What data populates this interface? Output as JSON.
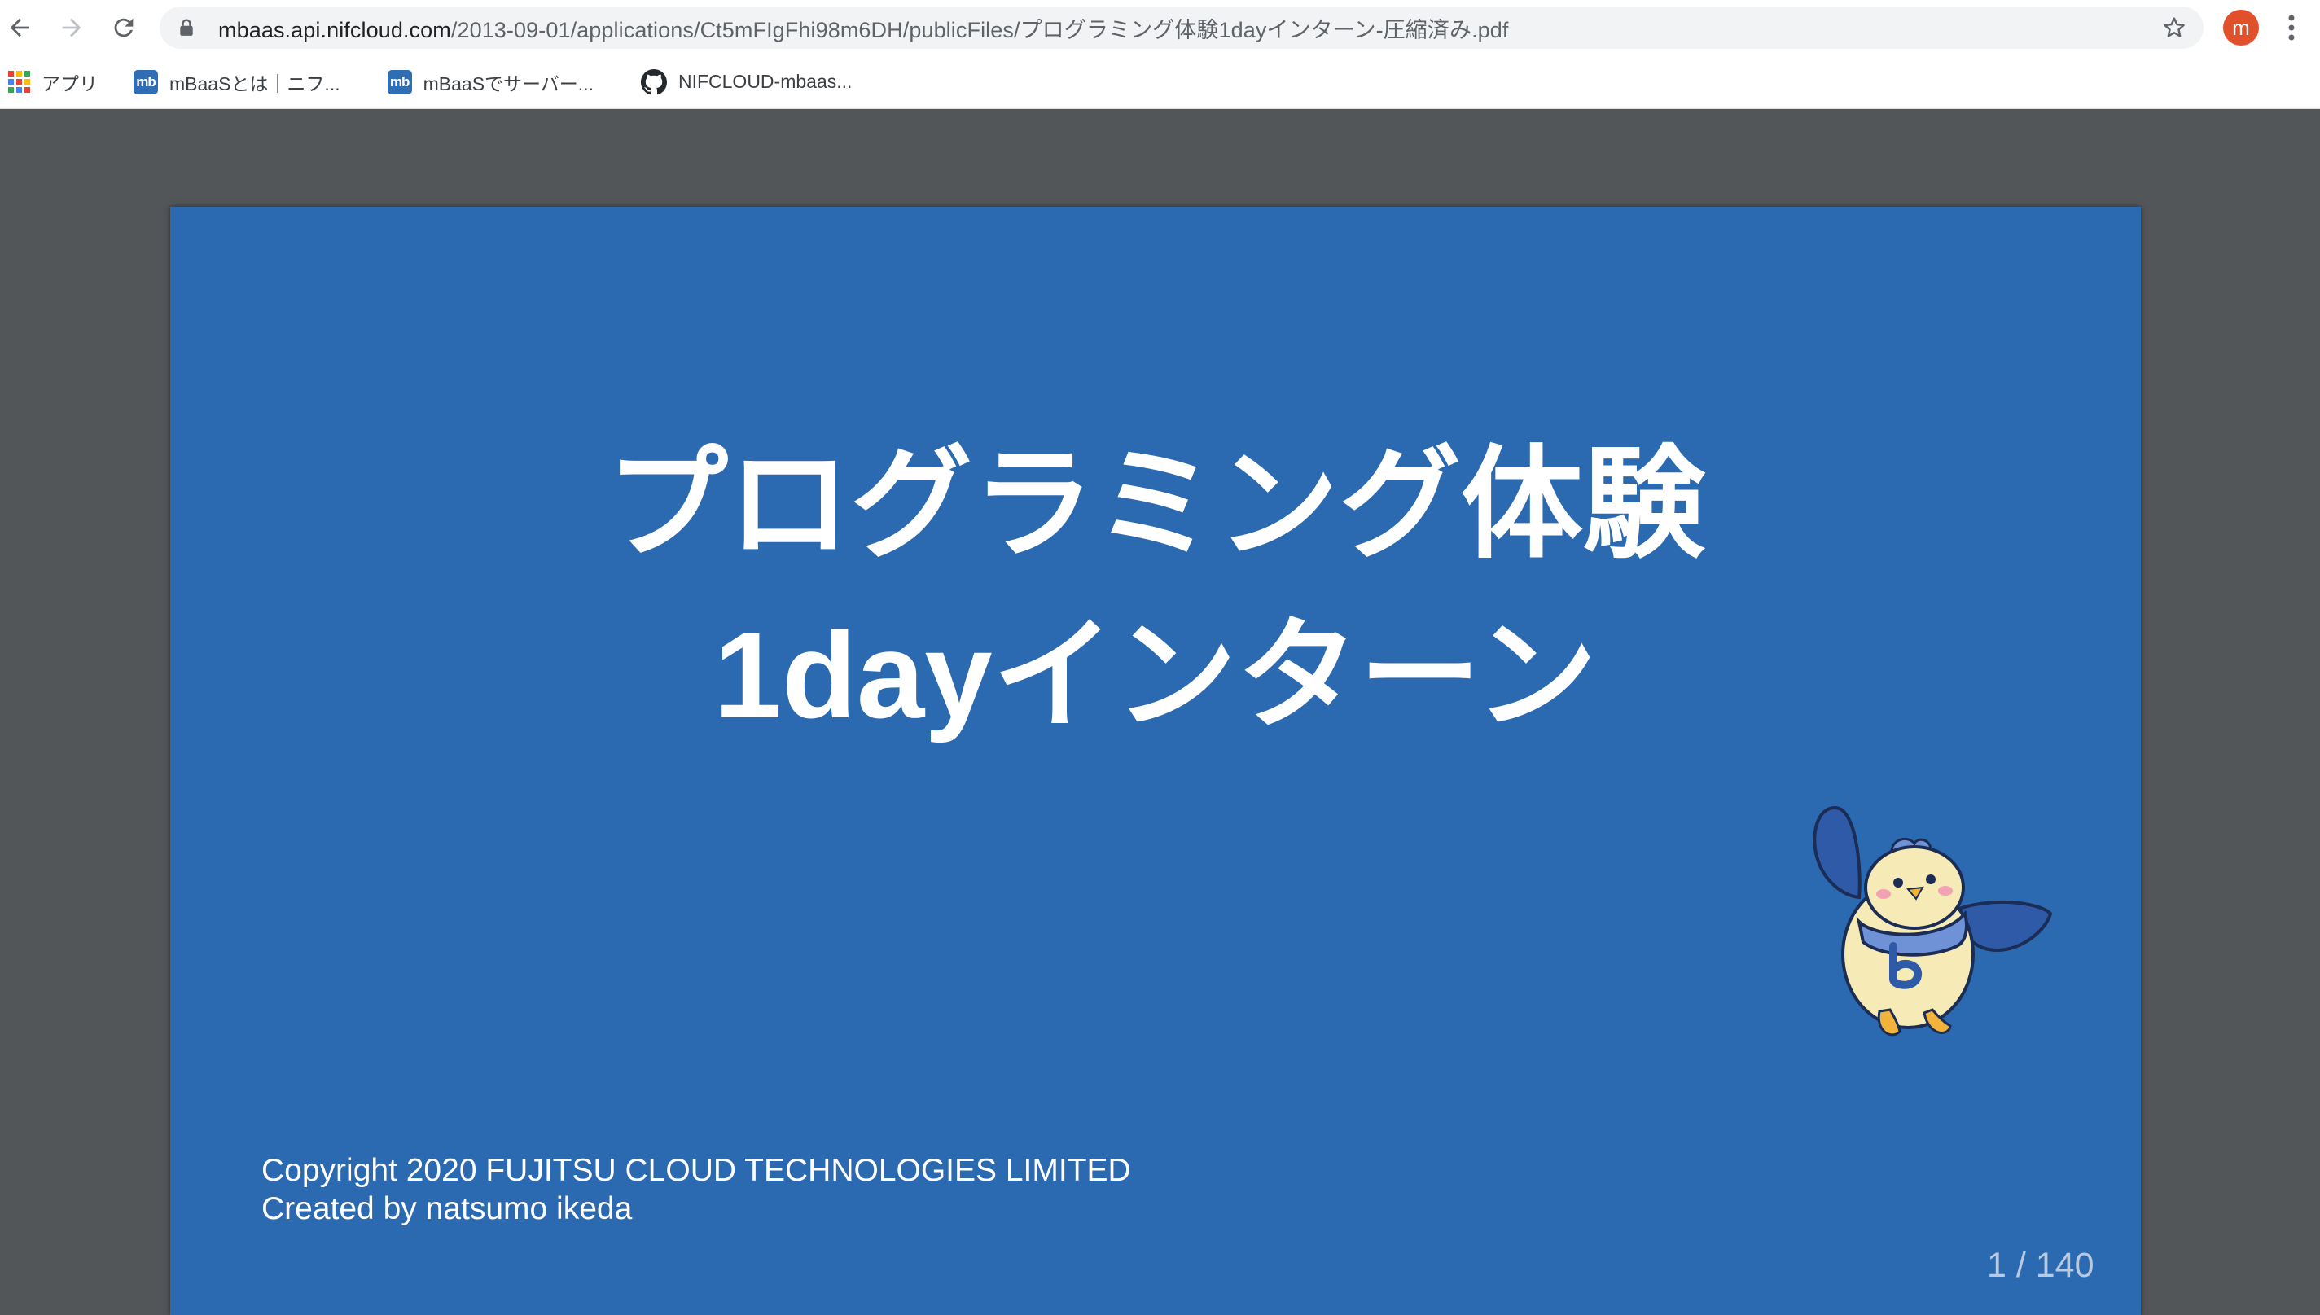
{
  "browser": {
    "url_host": "mbaas.api.nifcloud.com",
    "url_path": "/2013-09-01/applications/Ct5mFIgFhi98m6DH/publicFiles/プログラミング体験1dayインターン-圧縮済み.pdf",
    "profile_initial": "m",
    "accent_color": "#e0502a"
  },
  "bookmarks": [
    {
      "label": "アプリ",
      "icon": "apps-grid-icon"
    },
    {
      "label": "mBaaSとは｜ニフ...",
      "icon": "mbaas-favicon-icon"
    },
    {
      "label": "mBaaSでサーバー...",
      "icon": "mbaas-favicon-icon"
    },
    {
      "label": "NIFCLOUD-mbaas...",
      "icon": "github-icon"
    }
  ],
  "favicon_text": "mb",
  "slide": {
    "title_line1": "プログラミング体験",
    "title_line2": "1dayインターン",
    "copyright_line1": "Copyright 2020 FUJITSU CLOUD TECHNOLOGIES LIMITED",
    "copyright_line2": "Created by natsumo ikeda",
    "background_color": "#2b6ab0"
  },
  "pager": {
    "text": "1 / 140"
  }
}
